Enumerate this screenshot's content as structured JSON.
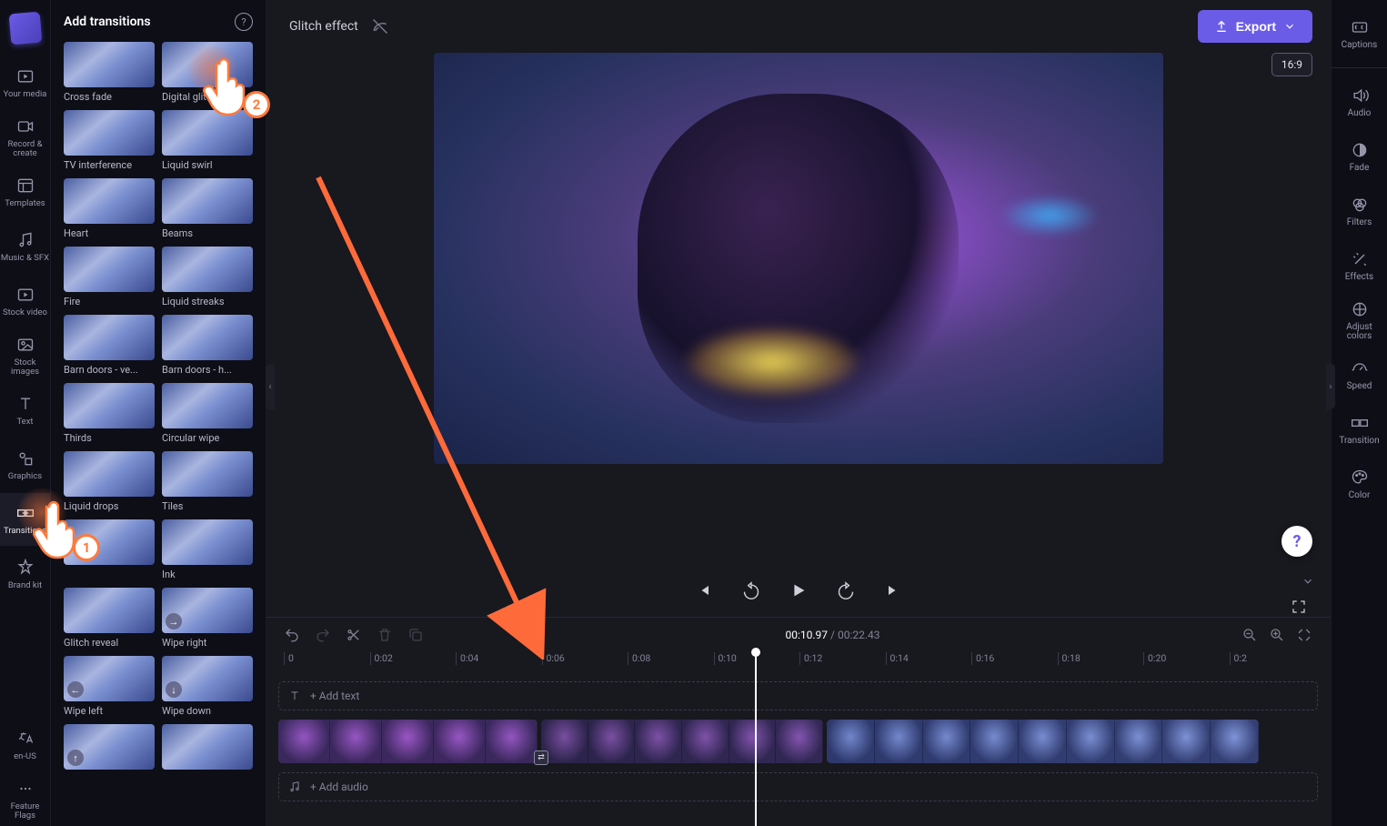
{
  "left_nav": {
    "items": [
      {
        "label": "Your media"
      },
      {
        "label": "Record & create"
      },
      {
        "label": "Templates"
      },
      {
        "label": "Music & SFX"
      },
      {
        "label": "Stock video"
      },
      {
        "label": "Stock images"
      },
      {
        "label": "Text"
      },
      {
        "label": "Graphics"
      },
      {
        "label": "Transitions"
      },
      {
        "label": "Brand kit"
      }
    ],
    "bottom": [
      {
        "label": "en-US"
      },
      {
        "label": "Feature Flags"
      }
    ]
  },
  "transitions_panel": {
    "title": "Add transitions",
    "items": [
      {
        "label": "Cross fade"
      },
      {
        "label": "Digital glitch"
      },
      {
        "label": "TV interference"
      },
      {
        "label": "Liquid swirl"
      },
      {
        "label": "Heart"
      },
      {
        "label": "Beams"
      },
      {
        "label": "Fire"
      },
      {
        "label": "Liquid streaks"
      },
      {
        "label": "Barn doors - ve..."
      },
      {
        "label": "Barn doors - h..."
      },
      {
        "label": "Thirds"
      },
      {
        "label": "Circular wipe"
      },
      {
        "label": "Liquid drops"
      },
      {
        "label": "Tiles"
      },
      {
        "label": ""
      },
      {
        "label": "Ink"
      },
      {
        "label": "Glitch reveal"
      },
      {
        "label": "Wipe right"
      },
      {
        "label": "Wipe left"
      },
      {
        "label": "Wipe down"
      }
    ]
  },
  "top_bar": {
    "media_title": "Glitch effect",
    "export_label": "Export",
    "aspect_ratio": "16:9"
  },
  "player": {
    "time_current": "00:10.97",
    "time_total": "00:22.43"
  },
  "ruler_ticks": [
    "0",
    "0:02",
    "0:04",
    "0:06",
    "0:08",
    "0:10",
    "0:12",
    "0:14",
    "0:16",
    "0:18",
    "0:20",
    "0:2"
  ],
  "tracks": {
    "add_text": "+ Add text",
    "add_audio": "+ Add audio"
  },
  "right_panel": {
    "items": [
      {
        "label": "Captions"
      },
      {
        "label": "Audio"
      },
      {
        "label": "Fade"
      },
      {
        "label": "Filters"
      },
      {
        "label": "Effects"
      },
      {
        "label": "Adjust colors"
      },
      {
        "label": "Speed"
      },
      {
        "label": "Transition"
      },
      {
        "label": "Color"
      }
    ]
  },
  "annotations": {
    "badge1": "1",
    "badge2": "2"
  }
}
